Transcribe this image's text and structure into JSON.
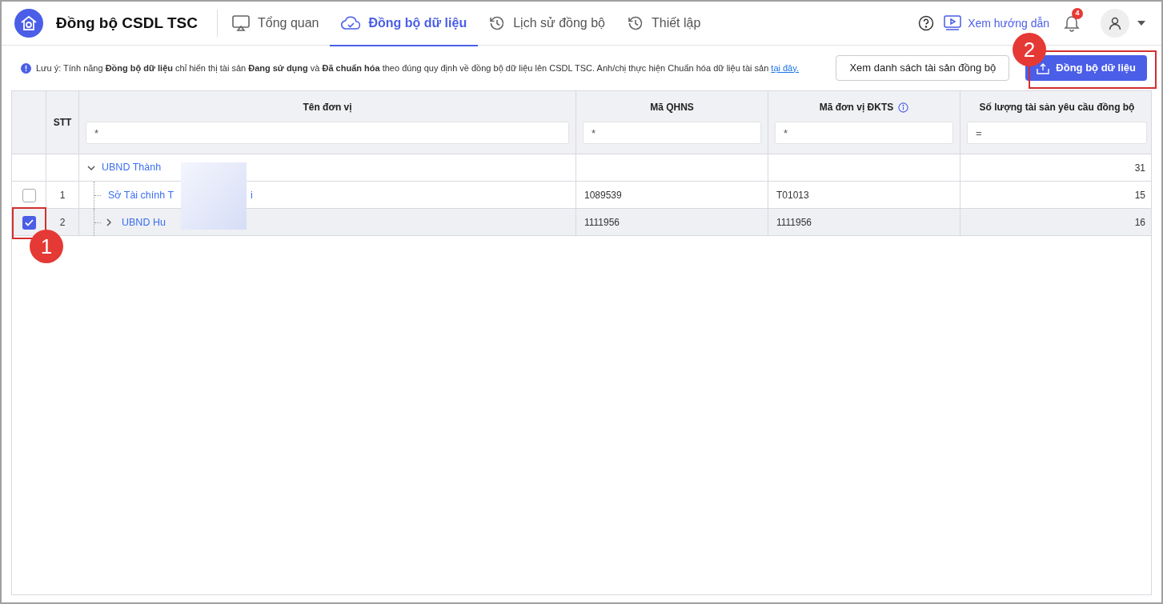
{
  "app": {
    "title": "Đồng bộ CSDL TSC"
  },
  "tabs": [
    {
      "label": "Tổng quan",
      "selected": false
    },
    {
      "label": "Đồng bộ dữ liệu",
      "selected": true
    },
    {
      "label": "Lịch sử đồng bộ",
      "selected": false
    },
    {
      "label": "Thiết lập",
      "selected": false
    }
  ],
  "header_actions": {
    "guide_link": "Xem hướng dẫn",
    "notification_count": "4"
  },
  "notice": {
    "text": "Lưu ý: Tính năng **Đồng bộ dữ liệu** chỉ hiển thị tài sản **Đang sử dụng** và **Đã chuẩn hóa** theo đúng quy định về đồng bộ dữ liệu lên CSDL TSC. Anh/chị thực hiện Chuẩn hóa dữ liệu tài sản",
    "link": "tại đây."
  },
  "buttons": [
    {
      "label": "Xem danh sách tài sản đồng bộ",
      "kind": "secondary"
    },
    {
      "label": "Đồng bộ dữ liệu",
      "kind": "primary"
    }
  ],
  "table": {
    "columns": [
      {
        "label": "STT"
      },
      {
        "label": "Tên đơn vị",
        "filter": "*"
      },
      {
        "label": "Mã QHNS",
        "filter": "*"
      },
      {
        "label": "Mã đơn vị ĐKTS",
        "filter": "*",
        "info": true
      },
      {
        "label": "Số lượng tài sản yêu cầu đồng bộ",
        "filter": "="
      }
    ],
    "rows": [
      {
        "kind": "group",
        "name": "UBND Thành",
        "expanded": true,
        "quantity": "31",
        "selected": false
      },
      {
        "kind": "leaf",
        "checked": false,
        "stt": "1",
        "name": "Sở Tài chính T",
        "name_tail": "i",
        "qhns": "1089539",
        "dkts": "T01013",
        "quantity": "15",
        "selected": false
      },
      {
        "kind": "branch",
        "checked": true,
        "stt": "2",
        "name": "UBND Hu",
        "expanded": false,
        "qhns": "1111956",
        "dkts": "1111956",
        "quantity": "16",
        "selected": true
      }
    ]
  },
  "callouts": [
    {
      "label": "1"
    },
    {
      "label": "2"
    }
  ]
}
